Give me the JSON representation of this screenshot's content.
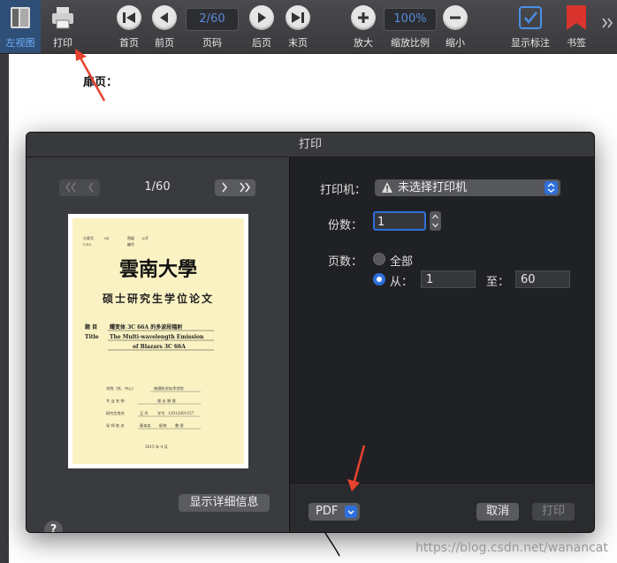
{
  "toolbar": {
    "left_view": "左视图",
    "print": "打印",
    "first_page": "首页",
    "prev_page": "前页",
    "page_field": "2/60",
    "page_number": "页码",
    "next_page": "后页",
    "last_page": "末页",
    "zoom_in": "放大",
    "zoom_field": "100%",
    "zoom_ratio": "缩放比例",
    "zoom_out": "缩小",
    "show_annotations": "显示标注",
    "bookmark": "书签"
  },
  "document": {
    "heading": "扉页："
  },
  "dialog": {
    "title": "打印",
    "preview": {
      "page_indicator": "1/60",
      "thumbnail": {
        "header_line1": "分类号",
        "header_code1": "04",
        "header_label2": "密级",
        "header_code2": "公开",
        "header_line2a": "UDC",
        "header_line2b": "编号",
        "university": "雲南大學",
        "degree": "硕士研究生学位论文",
        "title_label": "题 目",
        "title_cn": "耀变体 3C 66A 的多波段辐射",
        "title_en_label": "Title",
        "title_en1": "The Multi-wavelength Emission",
        "title_en2": "of Blazars 3C 66A",
        "school_label": "学院（所、中心）",
        "school": "物理科学技术学院",
        "major_label": "专 业 名 称",
        "major": "理 论 物 理",
        "student_label": "研究生姓名",
        "student": "王 丹",
        "id_label": "学号",
        "id": "12012001157",
        "advisor_label": "导 师 姓 名",
        "advisor": "蔡本忠",
        "title_label2": "职称",
        "advisor_title": "教 授",
        "date": "2015 年  4 月"
      },
      "details_button": "显示详细信息",
      "help_button": "?"
    },
    "settings": {
      "printer_label": "打印机：",
      "printer_value": "未选择打印机",
      "copies_label": "份数：",
      "copies_value": "1",
      "pages_label": "页数：",
      "pages_all": "全部",
      "pages_from": "从：",
      "from_value": "1",
      "pages_to": "至：",
      "to_value": "60",
      "pdf_button": "PDF",
      "cancel_button": "取消",
      "print_button": "打印"
    }
  },
  "watermark": "https://blog.csdn.net/wanancat",
  "colors": {
    "accent": "#2f6fdc",
    "annotation_arrow": "#e8432e",
    "toolbar_bg": "#3a3a3d",
    "thumb_paper": "#fbf2c3"
  }
}
